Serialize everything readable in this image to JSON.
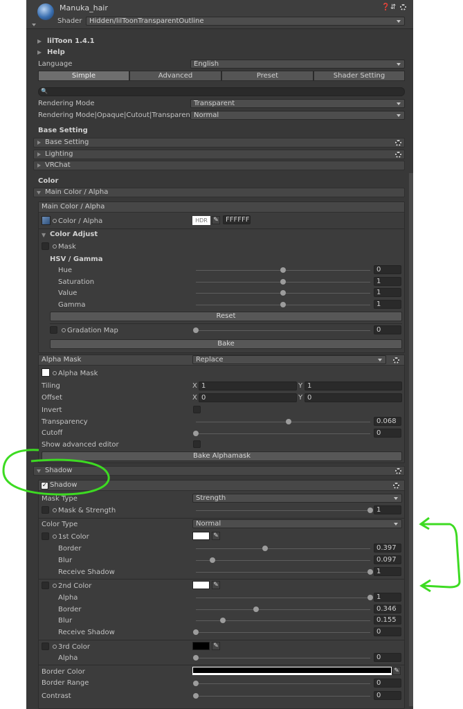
{
  "material": {
    "name": "Manuka_hair",
    "shader_label": "Shader",
    "shader_value": "Hidden/lilToonTransparentOutline"
  },
  "header_icons": [
    "help-icon",
    "preset-icon",
    "settings-icon"
  ],
  "sections": {
    "liltoon": "lilToon 1.4.1",
    "help": "Help",
    "language_label": "Language",
    "language_value": "English"
  },
  "tabs": [
    "Simple",
    "Advanced",
    "Preset",
    "Shader Setting"
  ],
  "search": {
    "value": ""
  },
  "rendering": {
    "mode_label": "Rendering Mode",
    "mode_value": "Transparent",
    "mode2_label": "Rendering Mode|Opaque|Cutout|Transparent|[",
    "mode2_value": "Normal"
  },
  "base": {
    "title": "Base Setting",
    "items": [
      "Base Setting",
      "Lighting",
      "VRChat"
    ]
  },
  "color": {
    "title": "Color",
    "fold": "Main Color / Alpha",
    "box_title": "Main Color / Alpha",
    "color_alpha": "Color / Alpha",
    "hdr": "HDR",
    "hex": "FFFFFF",
    "adjust": {
      "title": "Color Adjust",
      "mask": "Mask",
      "hsv": "HSV / Gamma",
      "rows": [
        {
          "label": "Hue",
          "value": "0",
          "pos": 0.5
        },
        {
          "label": "Saturation",
          "value": "1",
          "pos": 0.5
        },
        {
          "label": "Value",
          "value": "1",
          "pos": 0.5
        },
        {
          "label": "Gamma",
          "value": "1",
          "pos": 0.5
        }
      ],
      "reset": "Reset",
      "gradation": "Gradation Map",
      "gradation_value": "0",
      "bake": "Bake"
    }
  },
  "alpha": {
    "title": "Alpha Mask",
    "mode": "Replace",
    "mask": "Alpha Mask",
    "tiling": "Tiling",
    "offset": "Offset",
    "x": "X",
    "y": "Y",
    "tx": "1",
    "ty": "1",
    "ox": "0",
    "oy": "0",
    "invert": "Invert",
    "transparency": "Transparency",
    "transparency_value": "0.068",
    "transparency_pos": 0.53,
    "cutoff": "Cutoff",
    "cutoff_value": "0",
    "cutoff_pos": 0.0,
    "advanced": "Show advanced editor",
    "bake": "Bake Alphamask"
  },
  "shadow": {
    "fold": "Shadow",
    "box_title": "Shadow",
    "mask_type": "Mask Type",
    "mask_type_value": "Strength",
    "mask_strength": "Mask & Strength",
    "mask_strength_value": "1",
    "mask_strength_pos": 1.0,
    "color_type": "Color Type",
    "color_type_value": "Normal",
    "first": {
      "label": "1st Color",
      "rows": [
        {
          "label": "Border",
          "value": "0.397",
          "pos": 0.397
        },
        {
          "label": "Blur",
          "value": "0.097",
          "pos": 0.097
        },
        {
          "label": "Receive Shadow",
          "value": "1",
          "pos": 1.0
        }
      ]
    },
    "second": {
      "label": "2nd Color",
      "rows": [
        {
          "label": "Alpha",
          "value": "1",
          "pos": 1.0
        },
        {
          "label": "Border",
          "value": "0.346",
          "pos": 0.346
        },
        {
          "label": "Blur",
          "value": "0.155",
          "pos": 0.155
        },
        {
          "label": "Receive Shadow",
          "value": "0",
          "pos": 0.0
        }
      ]
    },
    "third": {
      "label": "3rd Color",
      "rows": [
        {
          "label": "Alpha",
          "value": "0",
          "pos": 0.0
        }
      ]
    },
    "border_color": "Border Color",
    "border_range": "Border Range",
    "border_range_value": "0",
    "contrast": "Contrast",
    "contrast_value": "0"
  },
  "colors": {
    "panel": "#383838",
    "annotation": "#3ddb22"
  }
}
